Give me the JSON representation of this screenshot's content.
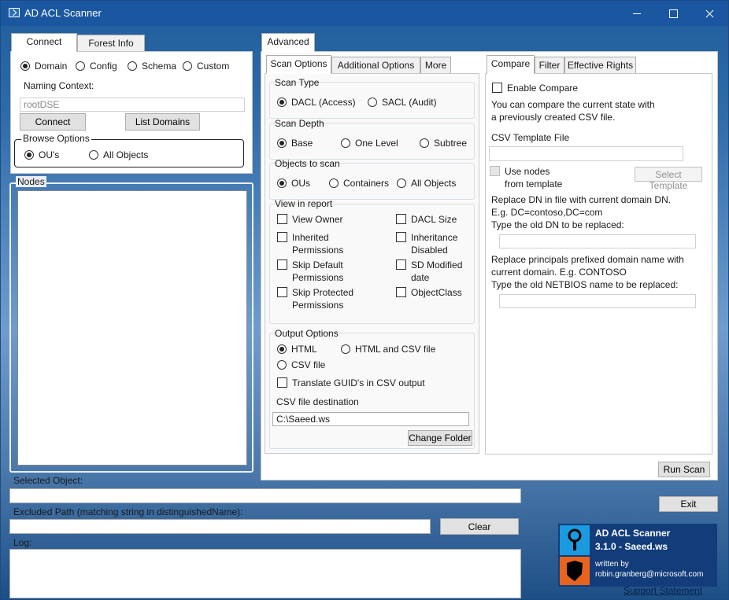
{
  "window": {
    "title": "AD ACL Scanner"
  },
  "connect": {
    "tabs": [
      "Connect",
      "Forest Info"
    ],
    "contexts": [
      "Domain",
      "Config",
      "Schema",
      "Custom"
    ],
    "selected_context": "Domain",
    "naming_context_label": "Naming Context:",
    "naming_context_value": "rootDSE",
    "connect_button": "Connect",
    "list_domains_button": "List Domains",
    "browse_options_label": "Browse Options",
    "browse_options": [
      "OU's",
      "All Objects"
    ],
    "selected_browse": "OU's"
  },
  "nodes": {
    "label": "Nodes"
  },
  "bottom": {
    "selected_object_label": "Selected Object:",
    "selected_object_value": "",
    "excluded_path_label": "Excluded Path (matching string in distinguishedName):",
    "excluded_path_value": "",
    "clear_button": "Clear",
    "log_label": "Log:",
    "exit_button": "Exit"
  },
  "advanced": {
    "tab_label": "Advanced",
    "subtabs": [
      "Scan Options",
      "Additional Options",
      "More"
    ],
    "scan_type": {
      "label": "Scan Type",
      "options": [
        "DACL (Access)",
        "SACL (Audit)"
      ],
      "selected": "DACL (Access)"
    },
    "scan_depth": {
      "label": "Scan Depth",
      "options": [
        "Base",
        "One Level",
        "Subtree"
      ],
      "selected": "Base"
    },
    "objects_to_scan": {
      "label": "Objects to scan",
      "options": [
        "OUs",
        "Containers",
        "All Objects"
      ],
      "selected": "OUs"
    },
    "view_in_report": {
      "label": "View in report",
      "items": [
        {
          "line1": "View Owner",
          "line2": "",
          "checked": false
        },
        {
          "line1": "DACL Size",
          "line2": "",
          "checked": false
        },
        {
          "line1": "Inherited",
          "line2": "Permissions",
          "checked": false
        },
        {
          "line1": "Inheritance",
          "line2": "Disabled",
          "checked": false
        },
        {
          "line1": "Skip Default",
          "line2": "Permissions",
          "checked": false
        },
        {
          "line1": "SD Modified",
          "line2": "date",
          "checked": false
        },
        {
          "line1": "Skip Protected",
          "line2": "Permissions",
          "checked": false
        },
        {
          "line1": "ObjectClass",
          "line2": "",
          "checked": false
        }
      ]
    },
    "output_options": {
      "label": "Output Options",
      "options": [
        "HTML",
        "HTML and CSV file",
        "CSV file"
      ],
      "selected": "HTML",
      "translate_guid_label": "Translate GUID's in CSV output",
      "csv_destination_label": "CSV file destination",
      "csv_destination_value": "C:\\Saeed.ws",
      "change_folder_button": "Change Folder"
    },
    "run_scan_button": "Run Scan"
  },
  "compare": {
    "tabs": [
      "Compare",
      "Filter",
      "Effective Rights"
    ],
    "enable_compare_label": "Enable Compare",
    "description_line1": "You can compare the current state with",
    "description_line2": "a previously created CSV file.",
    "template_file_label": "CSV Template File",
    "template_file_value": "",
    "use_nodes_line1": "Use nodes",
    "use_nodes_line2": "from template",
    "select_template_button": "Select Template",
    "replace_dn_line1": "Replace DN in file with current domain DN.",
    "replace_dn_line2": "E.g. DC=contoso,DC=com",
    "old_dn_label": "Type the old DN to be replaced:",
    "old_dn_value": "",
    "replace_principals_line1": "Replace principals prefixed domain name with",
    "replace_principals_line2": "current domain. E.g. CONTOSO",
    "old_netbios_label": "Type the old NETBIOS name to be replaced:",
    "old_netbios_value": ""
  },
  "about": {
    "product_name": "AD ACL Scanner",
    "version": "3.1.0 - Saeed.ws",
    "written_by_label": "written by",
    "author_email": "robin.granberg@microsoft.com",
    "support_link": "Support Statement"
  },
  "colors": {
    "titlebar": "#1a57a0",
    "accent_blue": "#0e62b8",
    "shield_orange": "#e8631c"
  }
}
